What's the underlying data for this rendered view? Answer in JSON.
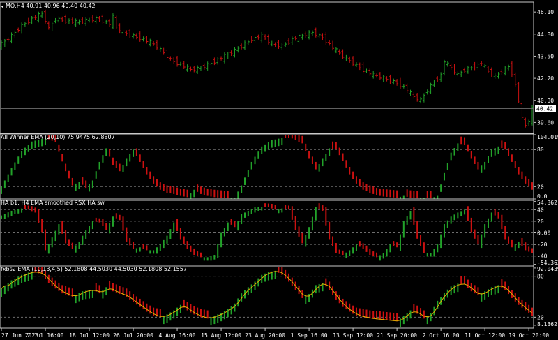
{
  "colors": {
    "background": "#000000",
    "up": "#22a32a",
    "down": "#cc1111",
    "frame": "#c8c8c8",
    "grid": "#6e6e6e",
    "ema": "#e8b000",
    "text": "#ffffff"
  },
  "chart_data": [
    {
      "id": "price",
      "type": "bar",
      "title": "MO,H4  40.91 40.96 40.40 40.42",
      "symbol": "MO,H4",
      "ohlc_header": [
        "40.91",
        "40.96",
        "40.40",
        "40.42"
      ],
      "ylim": [
        39.0,
        46.6
      ],
      "yticks": [
        "46.10",
        "44.80",
        "43.50",
        "42.20",
        "40.90",
        "39.60"
      ],
      "last_price": "40.42",
      "close_path": [
        [
          0,
          44.2
        ],
        [
          3,
          44.7
        ],
        [
          6,
          45.3
        ],
        [
          9,
          45.7
        ],
        [
          12,
          46.0
        ],
        [
          13,
          45.6
        ],
        [
          14,
          45.1
        ],
        [
          16,
          45.7
        ],
        [
          19,
          45.6
        ],
        [
          22,
          45.5
        ],
        [
          25,
          45.6
        ],
        [
          28,
          45.7
        ],
        [
          30,
          45.6
        ],
        [
          32,
          45.4
        ],
        [
          33,
          45.8
        ],
        [
          34,
          45.2
        ],
        [
          36,
          44.9
        ],
        [
          39,
          44.7
        ],
        [
          42,
          44.5
        ],
        [
          45,
          44.2
        ],
        [
          48,
          43.7
        ],
        [
          50,
          43.3
        ],
        [
          53,
          43.0
        ],
        [
          56,
          42.7
        ],
        [
          59,
          42.8
        ],
        [
          62,
          43.1
        ],
        [
          65,
          43.4
        ],
        [
          68,
          43.7
        ],
        [
          71,
          44.1
        ],
        [
          74,
          44.5
        ],
        [
          77,
          44.7
        ],
        [
          80,
          44.2
        ],
        [
          83,
          44.1
        ],
        [
          86,
          44.5
        ],
        [
          89,
          44.7
        ],
        [
          92,
          44.9
        ],
        [
          95,
          44.6
        ],
        [
          98,
          44.0
        ],
        [
          101,
          43.5
        ],
        [
          104,
          43.1
        ],
        [
          107,
          42.7
        ],
        [
          110,
          42.4
        ],
        [
          113,
          42.2
        ],
        [
          116,
          42.0
        ],
        [
          119,
          41.7
        ],
        [
          122,
          41.1
        ],
        [
          124,
          40.9
        ],
        [
          126,
          41.5
        ],
        [
          128,
          42.0
        ],
        [
          130,
          42.4
        ],
        [
          131,
          43.2
        ],
        [
          133,
          42.8
        ],
        [
          135,
          42.4
        ],
        [
          137,
          42.7
        ],
        [
          140,
          42.9
        ],
        [
          142,
          43.1
        ],
        [
          144,
          42.6
        ],
        [
          146,
          42.3
        ],
        [
          148,
          42.6
        ],
        [
          150,
          42.9
        ],
        [
          151,
          42.5
        ],
        [
          152,
          41.8
        ],
        [
          153,
          40.9
        ],
        [
          154,
          39.8
        ],
        [
          155,
          39.4
        ],
        [
          156,
          39.7
        ],
        [
          157,
          40.4
        ]
      ]
    },
    {
      "id": "all-winner-ema",
      "type": "bar",
      "title": "All Winner EMA (20,10) 75.9475 62.8807",
      "ylim": [
        0,
        104.0
      ],
      "yticks": [
        "104.019",
        "80",
        "20",
        "0.0"
      ],
      "levels": [
        80,
        20
      ],
      "path": [
        [
          0,
          20
        ],
        [
          3,
          50
        ],
        [
          6,
          78
        ],
        [
          9,
          93
        ],
        [
          13,
          99
        ],
        [
          16,
          92
        ],
        [
          19,
          45
        ],
        [
          21,
          22
        ],
        [
          23,
          28
        ],
        [
          25,
          18
        ],
        [
          27,
          30
        ],
        [
          29,
          60
        ],
        [
          31,
          82
        ],
        [
          33,
          55
        ],
        [
          35,
          45
        ],
        [
          37,
          65
        ],
        [
          39,
          80
        ],
        [
          41,
          60
        ],
        [
          43,
          40
        ],
        [
          45,
          25
        ],
        [
          47,
          15
        ],
        [
          49,
          10
        ],
        [
          51,
          8
        ],
        [
          53,
          5
        ],
        [
          55,
          3
        ],
        [
          57,
          15
        ],
        [
          59,
          8
        ],
        [
          61,
          5
        ],
        [
          63,
          3
        ],
        [
          65,
          2
        ],
        [
          67,
          1
        ],
        [
          69,
          2
        ],
        [
          71,
          22
        ],
        [
          74,
          60
        ],
        [
          77,
          85
        ],
        [
          80,
          95
        ],
        [
          83,
          99
        ],
        [
          86,
          98
        ],
        [
          89,
          90
        ],
        [
          91,
          65
        ],
        [
          93,
          48
        ],
        [
          95,
          65
        ],
        [
          97,
          82
        ],
        [
          99,
          80
        ],
        [
          101,
          62
        ],
        [
          103,
          40
        ],
        [
          105,
          25
        ],
        [
          107,
          15
        ],
        [
          109,
          10
        ],
        [
          111,
          6
        ],
        [
          113,
          4
        ],
        [
          115,
          3
        ],
        [
          117,
          2
        ],
        [
          119,
          5
        ],
        [
          121,
          2
        ],
        [
          123,
          1
        ],
        [
          125,
          2
        ],
        [
          127,
          1
        ],
        [
          129,
          5
        ],
        [
          131,
          42
        ],
        [
          133,
          75
        ],
        [
          135,
          90
        ],
        [
          137,
          88
        ],
        [
          139,
          65
        ],
        [
          141,
          48
        ],
        [
          143,
          60
        ],
        [
          145,
          80
        ],
        [
          147,
          85
        ],
        [
          149,
          80
        ],
        [
          151,
          60
        ],
        [
          153,
          40
        ],
        [
          155,
          25
        ],
        [
          157,
          15
        ]
      ]
    },
    {
      "id": "rsx-ha",
      "type": "bar",
      "title": "HA b1: H4 EMA smoothed RSX HA sw",
      "ylim": [
        -56,
        56
      ],
      "yticks": [
        "54.362",
        "40",
        "20",
        "0.00",
        "-20",
        "-40",
        "-54.362"
      ],
      "levels": [
        40,
        20,
        0,
        -20,
        -40
      ],
      "path": [
        [
          0,
          30
        ],
        [
          3,
          38
        ],
        [
          6,
          42
        ],
        [
          8,
          40
        ],
        [
          10,
          35
        ],
        [
          12,
          0
        ],
        [
          13,
          -30
        ],
        [
          15,
          -8
        ],
        [
          17,
          15
        ],
        [
          19,
          -18
        ],
        [
          21,
          -28
        ],
        [
          23,
          -15
        ],
        [
          25,
          5
        ],
        [
          27,
          20
        ],
        [
          29,
          18
        ],
        [
          31,
          5
        ],
        [
          33,
          28
        ],
        [
          35,
          22
        ],
        [
          37,
          -15
        ],
        [
          39,
          -28
        ],
        [
          41,
          -25
        ],
        [
          43,
          -30
        ],
        [
          45,
          -30
        ],
        [
          47,
          -20
        ],
        [
          49,
          -5
        ],
        [
          51,
          18
        ],
        [
          53,
          -12
        ],
        [
          55,
          -28
        ],
        [
          57,
          -38
        ],
        [
          59,
          -42
        ],
        [
          61,
          -42
        ],
        [
          63,
          -38
        ],
        [
          65,
          0
        ],
        [
          67,
          18
        ],
        [
          69,
          10
        ],
        [
          71,
          32
        ],
        [
          73,
          38
        ],
        [
          75,
          44
        ],
        [
          77,
          45
        ],
        [
          79,
          44
        ],
        [
          81,
          40
        ],
        [
          83,
          42
        ],
        [
          85,
          40
        ],
        [
          87,
          5
        ],
        [
          89,
          -18
        ],
        [
          91,
          10
        ],
        [
          93,
          45
        ],
        [
          95,
          38
        ],
        [
          97,
          -12
        ],
        [
          99,
          -35
        ],
        [
          101,
          -38
        ],
        [
          103,
          -30
        ],
        [
          105,
          -20
        ],
        [
          107,
          -28
        ],
        [
          109,
          -38
        ],
        [
          111,
          -42
        ],
        [
          113,
          -35
        ],
        [
          115,
          -20
        ],
        [
          117,
          -25
        ],
        [
          119,
          20
        ],
        [
          121,
          38
        ],
        [
          123,
          -10
        ],
        [
          125,
          -35
        ],
        [
          127,
          -35
        ],
        [
          129,
          -20
        ],
        [
          131,
          15
        ],
        [
          133,
          28
        ],
        [
          135,
          35
        ],
        [
          137,
          40
        ],
        [
          139,
          0
        ],
        [
          141,
          -20
        ],
        [
          143,
          15
        ],
        [
          145,
          35
        ],
        [
          147,
          25
        ],
        [
          149,
          -12
        ],
        [
          151,
          -25
        ],
        [
          153,
          -15
        ],
        [
          155,
          -30
        ],
        [
          157,
          -35
        ]
      ]
    },
    {
      "id": "fxbs2-ema",
      "type": "bar",
      "title": "fxbs2 EMA (10,13,4,5) 52.1808 44.5030 44.5030 52.1808 52.1557",
      "ylim": [
        6,
        94
      ],
      "yticks": [
        "92.0439",
        "80",
        "20",
        "8.1362"
      ],
      "levels": [
        80,
        20
      ],
      "path": [
        [
          0,
          62
        ],
        [
          3,
          74
        ],
        [
          6,
          82
        ],
        [
          9,
          87
        ],
        [
          12,
          83
        ],
        [
          14,
          70
        ],
        [
          16,
          62
        ],
        [
          18,
          55
        ],
        [
          21,
          50
        ],
        [
          24,
          58
        ],
        [
          27,
          60
        ],
        [
          29,
          55
        ],
        [
          31,
          64
        ],
        [
          33,
          58
        ],
        [
          35,
          54
        ],
        [
          37,
          50
        ],
        [
          39,
          42
        ],
        [
          41,
          35
        ],
        [
          43,
          28
        ],
        [
          45,
          22
        ],
        [
          47,
          20
        ],
        [
          49,
          24
        ],
        [
          51,
          30
        ],
        [
          53,
          38
        ],
        [
          55,
          30
        ],
        [
          57,
          24
        ],
        [
          59,
          20
        ],
        [
          61,
          18
        ],
        [
          63,
          22
        ],
        [
          65,
          26
        ],
        [
          67,
          32
        ],
        [
          69,
          40
        ],
        [
          71,
          55
        ],
        [
          73,
          64
        ],
        [
          75,
          72
        ],
        [
          77,
          82
        ],
        [
          79,
          86
        ],
        [
          81,
          88
        ],
        [
          83,
          82
        ],
        [
          85,
          72
        ],
        [
          87,
          60
        ],
        [
          89,
          48
        ],
        [
          91,
          54
        ],
        [
          93,
          67
        ],
        [
          95,
          70
        ],
        [
          97,
          60
        ],
        [
          99,
          46
        ],
        [
          101,
          35
        ],
        [
          103,
          28
        ],
        [
          105,
          22
        ],
        [
          107,
          20
        ],
        [
          109,
          18
        ],
        [
          111,
          17
        ],
        [
          113,
          16
        ],
        [
          115,
          15
        ],
        [
          117,
          14
        ],
        [
          119,
          22
        ],
        [
          121,
          30
        ],
        [
          123,
          25
        ],
        [
          125,
          18
        ],
        [
          127,
          26
        ],
        [
          129,
          44
        ],
        [
          131,
          56
        ],
        [
          133,
          65
        ],
        [
          135,
          69
        ],
        [
          137,
          68
        ],
        [
          139,
          58
        ],
        [
          141,
          52
        ],
        [
          143,
          58
        ],
        [
          145,
          64
        ],
        [
          147,
          67
        ],
        [
          149,
          60
        ],
        [
          151,
          48
        ],
        [
          153,
          38
        ],
        [
          155,
          30
        ],
        [
          157,
          22
        ]
      ]
    }
  ],
  "x_axis": {
    "labels": [
      "27 Jun 2023",
      "7 Jul 16:00",
      "18 Jul 12:00",
      "26 Jul 20:00",
      "4 Aug 16:00",
      "15 Aug 12:00",
      "23 Aug 20:00",
      "1 Sep 16:00",
      "13 Sep 12:00",
      "21 Sep 20:00",
      "2 Oct 16:00",
      "11 Oct 12:00",
      "19 Oct 20:00"
    ],
    "positions": [
      0,
      13,
      26,
      39,
      52,
      65,
      78,
      91,
      104,
      117,
      130,
      143,
      156
    ],
    "bar_count": 158
  }
}
